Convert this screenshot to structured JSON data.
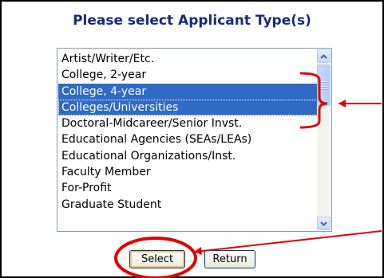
{
  "title": "Please select Applicant Type(s)",
  "listbox": {
    "options": [
      {
        "label": "Artist/Writer/Etc.",
        "selected": false
      },
      {
        "label": "College, 2-year",
        "selected": false
      },
      {
        "label": "College, 4-year",
        "selected": true
      },
      {
        "label": "Colleges/Universities",
        "selected": true
      },
      {
        "label": "Doctoral-Midcareer/Senior Invst.",
        "selected": false
      },
      {
        "label": "Educational Agencies (SEAs/LEAs)",
        "selected": false
      },
      {
        "label": "Educational Organizations/Inst.",
        "selected": false
      },
      {
        "label": "Faculty Member",
        "selected": false
      },
      {
        "label": "For-Profit",
        "selected": false
      },
      {
        "label": "Graduate Student",
        "selected": false
      }
    ],
    "scroll_position": 0.0
  },
  "buttons": {
    "select_label": "Select",
    "return_label": "Return"
  },
  "colors": {
    "title": "#1a2a78",
    "selection": "#3169c6",
    "annotation": "#e00000"
  },
  "icons": {
    "scroll_up": "chevron-up-icon",
    "scroll_down": "chevron-down-icon"
  }
}
